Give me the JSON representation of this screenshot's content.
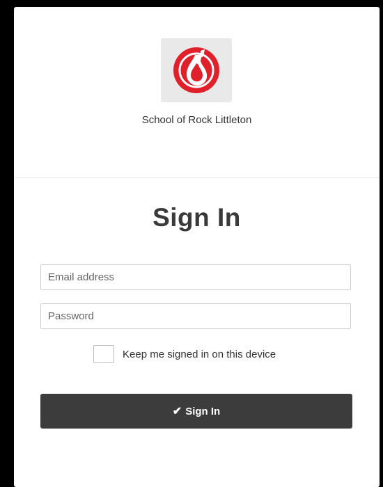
{
  "brand": {
    "logo_icon": "guitar-circle-logo-icon",
    "accent_color": "#e0202a",
    "org_name": "School of Rock Littleton"
  },
  "form": {
    "title": "Sign In",
    "email_placeholder": "Email address",
    "password_placeholder": "Password",
    "remember_label": "Keep me signed in on this device",
    "remember_checked": false,
    "submit_icon": "checkmark-icon",
    "submit_label": "Sign In"
  }
}
